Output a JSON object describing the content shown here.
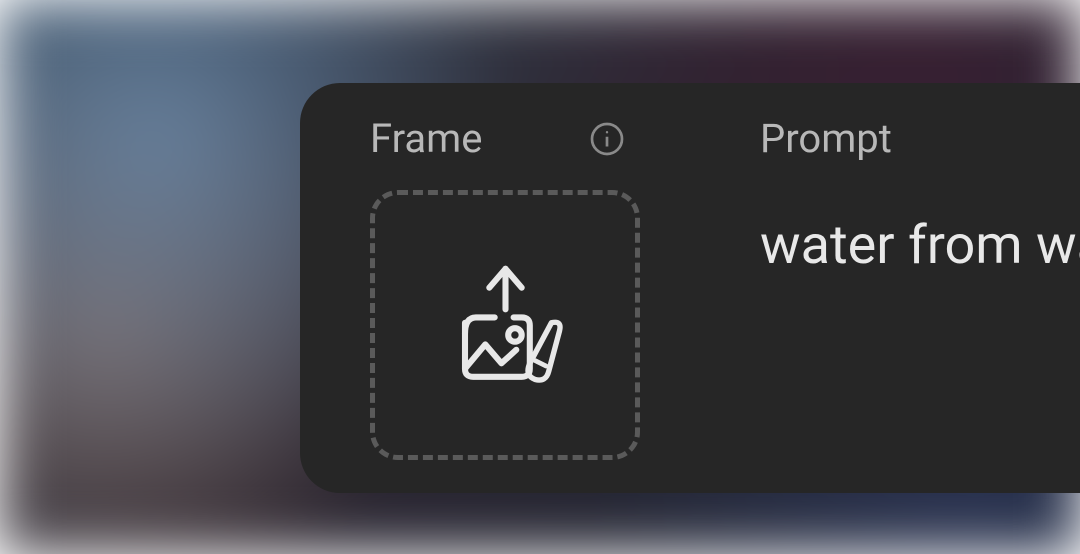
{
  "frame": {
    "label": "Frame"
  },
  "prompt": {
    "label": "Prompt",
    "value": "water from wa"
  }
}
